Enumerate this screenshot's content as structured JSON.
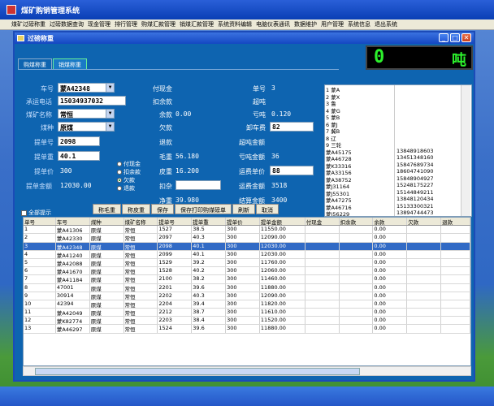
{
  "app": {
    "title": "煤矿购销管理系统"
  },
  "menu": [
    "煤矿过磅称重",
    "过磅数据查询",
    "现金管理",
    "排行管理",
    "购煤汇款管理",
    "销煤汇款管理",
    "系统资料编辑",
    "电脑仪表通讯",
    "数据维护",
    "用户管理",
    "系统信息",
    "退出系统"
  ],
  "window": {
    "title": "过磅称重",
    "min": "_",
    "max": "□",
    "close": "✕"
  },
  "tabs": [
    "购煤称重",
    "销煤称重"
  ],
  "display": {
    "value": "0",
    "unit": "吨"
  },
  "form": {
    "plate_label": "车号",
    "plate": "蒙A42348",
    "phone_label": "承运电话",
    "phone": "15034937032",
    "mine_label": "煤矿名称",
    "mine": "常恒",
    "coal_label": "煤种",
    "coal": "原煤",
    "bill_label": "提单号",
    "bill": "2098",
    "weight_label": "提单重",
    "weight": "40.1",
    "price_label": "提单价",
    "price": "300",
    "amount_label": "提单金额",
    "amount": "12030.00"
  },
  "radios": [
    {
      "label": "付现金",
      "on": false
    },
    {
      "label": "扣余款",
      "on": false
    },
    {
      "label": "欠款",
      "on": true
    },
    {
      "label": "退款",
      "on": false
    }
  ],
  "mid": {
    "paycash": "付现金",
    "deduct": "扣余款",
    "balance_label": "余款",
    "balance": "0.00",
    "debt": "欠款",
    "refund": "退款",
    "gross_label": "毛重",
    "gross": "56.180",
    "tare_label": "皮重",
    "tare": "16.200",
    "deductwt": "扣杂",
    "net_label": "净重",
    "net": "39.980"
  },
  "right": {
    "serial_label": "单号",
    "serial": "3",
    "over": "超吨",
    "shortage_label": "亏吨",
    "shortage": "0.120",
    "unload_label": "卸车费",
    "unload": "82",
    "over_amount": "超吨金额",
    "shortage_amount_label": "亏吨金额",
    "shortage_amount": "36",
    "freight_price_label": "运费单价",
    "freight_price": "88",
    "freight_amount_label": "运费金额",
    "freight_amount": "3518",
    "settle_label": "结算金额",
    "settle": "3400"
  },
  "listbox": [
    [
      "1 蒙A",
      ""
    ],
    [
      "2 蒙X",
      ""
    ],
    [
      "3 鲁",
      ""
    ],
    [
      "4 蒙G",
      ""
    ],
    [
      "5 蒙B",
      ""
    ],
    [
      "6 蒙J",
      ""
    ],
    [
      "7 冀B",
      ""
    ],
    [
      "8 辽",
      ""
    ],
    [
      "9 三轮",
      ""
    ],
    [
      "蒙A45175",
      "13848918603"
    ],
    [
      "蒙A46728",
      "13451348160"
    ],
    [
      "蒙K33316",
      "15847689734"
    ],
    [
      "蒙A33156",
      "18604741090"
    ],
    [
      "蒙A38752",
      "15848904927"
    ],
    [
      "蒙J31164",
      "15248175227"
    ],
    [
      "蒙J55301",
      "15144849211"
    ],
    [
      "蒙A47275",
      "13848120434"
    ],
    [
      "蒙A46716",
      "15133300321"
    ],
    [
      "蒙J56229",
      "13894744473"
    ]
  ],
  "buttons": [
    "称毛重",
    "称皮重",
    "保存",
    "保存打印购煤磅单",
    "刷新",
    "取消"
  ],
  "checkall": "全部提示",
  "grid": {
    "headers": [
      "单号",
      "车号",
      "煤种",
      "煤矿名称",
      "提单号",
      "提单重",
      "提单价",
      "提单金额",
      "付现金",
      "扣余款",
      "余款",
      "欠款",
      "退款"
    ],
    "rows": [
      [
        "1",
        "蒙A41306",
        "原煤",
        "常恒",
        "1527",
        "38.5",
        "300",
        "11550.00",
        "",
        "",
        "0.00",
        "",
        ""
      ],
      [
        "2",
        "蒙A42330",
        "原煤",
        "常恒",
        "2097",
        "40.3",
        "300",
        "12090.00",
        "",
        "",
        "0.00",
        "",
        ""
      ],
      [
        "3",
        "蒙A42348",
        "原煤",
        "常恒",
        "2098",
        "40.1",
        "300",
        "12030.00",
        "",
        "",
        "0.00",
        "",
        ""
      ],
      [
        "4",
        "蒙A41240",
        "原煤",
        "常恒",
        "2099",
        "40.1",
        "300",
        "12030.00",
        "",
        "",
        "0.00",
        "",
        ""
      ],
      [
        "5",
        "蒙A42088",
        "原煤",
        "常恒",
        "1529",
        "39.2",
        "300",
        "11760.00",
        "",
        "",
        "0.00",
        "",
        ""
      ],
      [
        "6",
        "蒙A41670",
        "原煤",
        "常恒",
        "1528",
        "40.2",
        "300",
        "12060.00",
        "",
        "",
        "0.00",
        "",
        ""
      ],
      [
        "7",
        "蒙A41184",
        "原煤",
        "常恒",
        "2100",
        "38.2",
        "300",
        "11460.00",
        "",
        "",
        "0.00",
        "",
        ""
      ],
      [
        "8",
        "47001",
        "原煤",
        "常恒",
        "2201",
        "39.6",
        "300",
        "11880.00",
        "",
        "",
        "0.00",
        "",
        ""
      ],
      [
        "9",
        "30914",
        "原煤",
        "常恒",
        "2202",
        "40.3",
        "300",
        "12090.00",
        "",
        "",
        "0.00",
        "",
        ""
      ],
      [
        "10",
        "42394",
        "原煤",
        "常恒",
        "2204",
        "39.4",
        "300",
        "11820.00",
        "",
        "",
        "0.00",
        "",
        ""
      ],
      [
        "11",
        "蒙A42049",
        "原煤",
        "常恒",
        "2212",
        "38.7",
        "300",
        "11610.00",
        "",
        "",
        "0.00",
        "",
        ""
      ],
      [
        "12",
        "蒙K82774",
        "原煤",
        "常恒",
        "2203",
        "38.4",
        "300",
        "11520.00",
        "",
        "",
        "0.00",
        "",
        ""
      ],
      [
        "13",
        "蒙A46297",
        "原煤",
        "常恒",
        "1524",
        "39.6",
        "300",
        "11880.00",
        "",
        "",
        "0.00",
        "",
        ""
      ]
    ],
    "selected_row": 3
  }
}
